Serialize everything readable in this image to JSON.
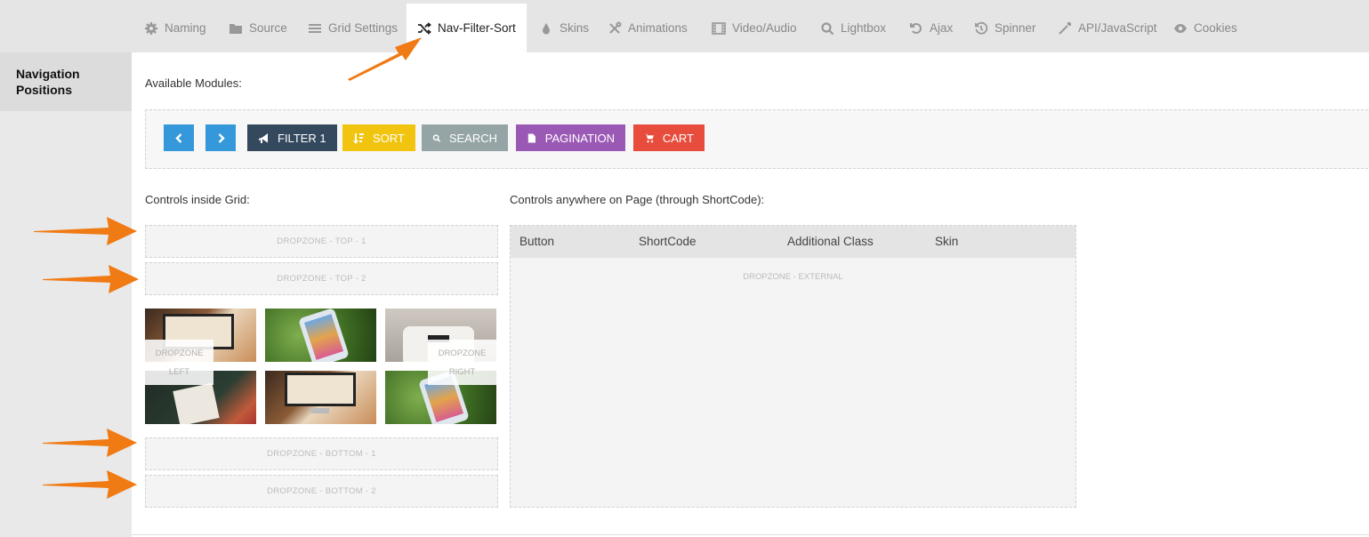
{
  "tabs": [
    {
      "id": "naming",
      "label": "Naming",
      "icon": "gear-icon"
    },
    {
      "id": "source",
      "label": "Source",
      "icon": "folder-icon"
    },
    {
      "id": "grid",
      "label": "Grid Settings",
      "icon": "list-icon"
    },
    {
      "id": "navfilter",
      "label": "Nav-Filter-Sort",
      "icon": "shuffle-icon",
      "active": true
    },
    {
      "id": "skins",
      "label": "Skins",
      "icon": "drop-icon"
    },
    {
      "id": "animations",
      "label": "Animations",
      "icon": "tools-icon"
    },
    {
      "id": "video",
      "label": "Video/Audio",
      "icon": "film-icon"
    },
    {
      "id": "lightbox",
      "label": "Lightbox",
      "icon": "search-icon"
    },
    {
      "id": "ajax",
      "label": "Ajax",
      "icon": "undo-icon"
    },
    {
      "id": "spinner",
      "label": "Spinner",
      "icon": "history-icon"
    },
    {
      "id": "api",
      "label": "API/JavaScript",
      "icon": "magic-wand-icon"
    },
    {
      "id": "cookies",
      "label": "Cookies",
      "icon": "eye-icon"
    }
  ],
  "sidebar": {
    "item": "Navigation Positions"
  },
  "labels": {
    "available": "Available Modules:",
    "inside": "Controls inside Grid:",
    "anywhere": "Controls anywhere on Page (through ShortCode):"
  },
  "modules": {
    "prev": "chevron-left-icon",
    "next": "chevron-right-icon",
    "filter": "Filter 1",
    "sort": "Sort",
    "search": "Search",
    "pagination": "Pagination",
    "cart": "Cart"
  },
  "colors": {
    "nav_blue": "#3498db",
    "filter": "#34495e",
    "sort": "#f1c40f",
    "search": "#95a5a6",
    "pagination": "#9b59b6",
    "cart": "#e74c3c",
    "arrow": "#f07a14"
  },
  "dropzones": {
    "top1": "DROPZONE - TOP - 1",
    "top2": "DROPZONE - TOP - 2",
    "left1": "DROPZONE",
    "left2": "LEFT",
    "right1": "DROPZONE",
    "right2": "RIGHT",
    "bottom1": "DROPZONE - BOTTOM - 1",
    "bottom2": "DROPZONE - BOTTOM - 2",
    "external": "DROPZONE - EXTERNAL"
  },
  "table": {
    "headers": [
      "Button",
      "ShortCode",
      "Additional Class",
      "Skin"
    ]
  }
}
